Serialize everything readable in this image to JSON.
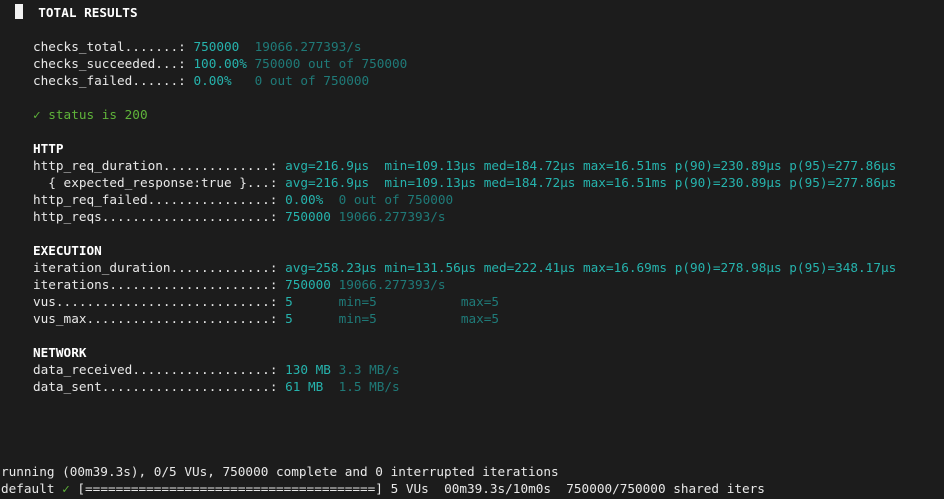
{
  "header": {
    "title": "TOTAL RESULTS"
  },
  "checks": {
    "total": {
      "label": "checks_total",
      "dots": ".......",
      "value": "750000",
      "rate": "19066.277393/s"
    },
    "succeeded": {
      "label": "checks_succeeded",
      "dots": "...",
      "value": "100.00%",
      "detail": "750000 out of 750000"
    },
    "failed": {
      "label": "checks_failed",
      "dots": "......",
      "value": "0.00%",
      "detail": "0 out of 750000"
    },
    "status_line": "✓ status is 200"
  },
  "http": {
    "heading": "HTTP",
    "req_duration": {
      "label": "http_req_duration",
      "dots": "..............",
      "avg": "avg=216.9µs",
      "min": "min=109.13µs",
      "med": "med=184.72µs",
      "max": "max=16.51ms",
      "p90": "p(90)=230.89µs",
      "p95": "p(95)=277.86µs"
    },
    "expected": {
      "label": "  { expected_response:true }",
      "dots": "...",
      "avg": "avg=216.9µs",
      "min": "min=109.13µs",
      "med": "med=184.72µs",
      "max": "max=16.51ms",
      "p90": "p(90)=230.89µs",
      "p95": "p(95)=277.86µs"
    },
    "req_failed": {
      "label": "http_req_failed",
      "dots": "................",
      "value": "0.00%",
      "detail": "0 out of 750000"
    },
    "reqs": {
      "label": "http_reqs",
      "dots": "......................",
      "value": "750000",
      "rate": "19066.277393/s"
    }
  },
  "execution": {
    "heading": "EXECUTION",
    "iteration_duration": {
      "label": "iteration_duration",
      "dots": ".............",
      "avg": "avg=258.23µs",
      "min": "min=131.56µs",
      "med": "med=222.41µs",
      "max": "max=16.69ms",
      "p90": "p(90)=278.98µs",
      "p95": "p(95)=348.17µs"
    },
    "iterations": {
      "label": "iterations",
      "dots": ".....................",
      "value": "750000",
      "rate": "19066.277393/s"
    },
    "vus": {
      "label": "vus",
      "dots": "............................",
      "value": "5",
      "min": "min=5",
      "max": "max=5"
    },
    "vus_max": {
      "label": "vus_max",
      "dots": "........................",
      "value": "5",
      "min": "min=5",
      "max": "max=5"
    }
  },
  "network": {
    "heading": "NETWORK",
    "received": {
      "label": "data_received",
      "dots": "..................",
      "value": "130 MB",
      "rate": "3.3 MB/s"
    },
    "sent": {
      "label": "data_sent",
      "dots": "......................",
      "value": "61 MB",
      "rate": "1.5 MB/s"
    }
  },
  "footer": {
    "running": "running (00m39.3s), 0/5 VUs, 750000 complete and 0 interrupted iterations",
    "scenario": "default",
    "check": "✓",
    "progress": "[======================================]",
    "progress_fraction": 1.0,
    "tail": "5 VUs  00m39.3s/10m0s  750000/750000 shared iters"
  }
}
